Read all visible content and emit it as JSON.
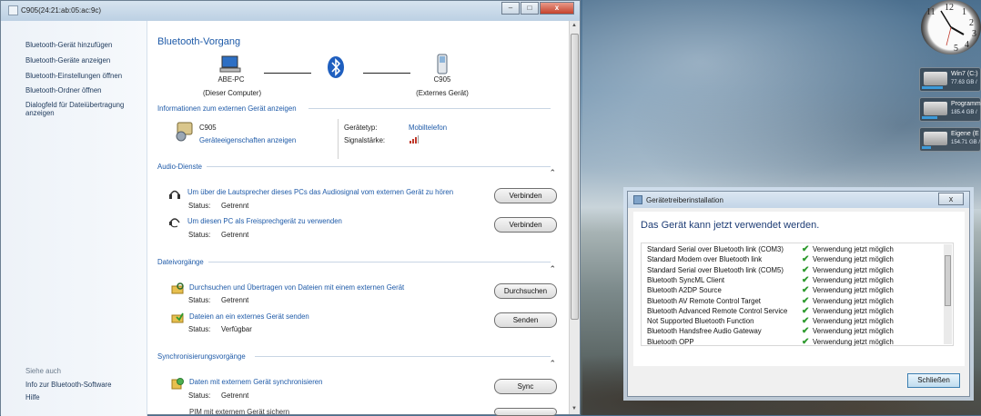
{
  "window": {
    "title": "C905(24:21:ab:05:ac:9c)",
    "buttons": {
      "minimize": "–",
      "maximize": "□",
      "close": "x"
    }
  },
  "sidebar": {
    "items": [
      {
        "label": "Bluetooth-Gerät hinzufügen"
      },
      {
        "label": "Bluetooth-Geräte anzeigen"
      },
      {
        "label": "Bluetooth-Einstellungen öffnen"
      },
      {
        "label": "Bluetooth-Ordner öffnen"
      },
      {
        "label": "Dialogfeld für Dateiübertragung anzeigen"
      }
    ],
    "see_also_title": "Siehe auch",
    "see_also": [
      {
        "label": "Info zur Bluetooth-Software"
      },
      {
        "label": "Hilfe"
      }
    ]
  },
  "main": {
    "title": "Bluetooth-Vorgang",
    "local_device": {
      "name": "ABE-PC",
      "caption": "(Dieser Computer)"
    },
    "remote_device": {
      "name": "C905",
      "caption": "(Externes Gerät)"
    },
    "info_section": {
      "title": "Informationen zum externen Gerät anzeigen",
      "device_name": "C905",
      "properties_link": "Geräteeigenschaften anzeigen",
      "device_type_label": "Gerätetyp:",
      "device_type_value": "Mobiltelefon",
      "signal_label": "Signalstärke:"
    },
    "audio_section": {
      "title": "Audio-Dienste",
      "services": [
        {
          "text": "Um über die Lautsprecher dieses PCs das Audiosignal vom externen Gerät zu hören",
          "status_label": "Status:",
          "status": "Getrennt",
          "button": "Verbinden"
        },
        {
          "text": "Um diesen PC als Freisprechgerät zu verwenden",
          "status_label": "Status:",
          "status": "Getrennt",
          "button": "Verbinden"
        }
      ]
    },
    "file_section": {
      "title": "Dateivorgänge",
      "services": [
        {
          "text": "Durchsuchen und Übertragen von Dateien mit einem externen Gerät",
          "status_label": "Status:",
          "status": "Getrennt",
          "button": "Durchsuchen"
        },
        {
          "text": "Dateien an ein externes Gerät senden",
          "status_label": "Status:",
          "status": "Verfügbar",
          "button": "Senden"
        }
      ]
    },
    "sync_section": {
      "title": "Synchronisierungsvorgänge",
      "services": [
        {
          "text": "Daten mit externem Gerät synchronisieren",
          "status_label": "Status:",
          "status": "Getrennt",
          "button": "Sync"
        }
      ],
      "partial_item": "PIM mit externem Gerät sichern"
    }
  },
  "desktop": {
    "clock_numbers": [
      "11",
      "12",
      "1",
      "2",
      "3",
      "4",
      "5"
    ],
    "drives": [
      {
        "name": "Win7 (C:)",
        "size": "77.63 GB /",
        "fill": 0.35
      },
      {
        "name": "Programm",
        "size": "185.4 GB /",
        "fill": 0.25
      },
      {
        "name": "Eigene (E",
        "size": "154.71 GB /",
        "fill": 0.15
      }
    ]
  },
  "dialog": {
    "title": "Gerätetreiberinstallation",
    "close": "x",
    "message": "Das Gerät kann jetzt verwendet werden.",
    "items": [
      {
        "name": "Standard Serial over Bluetooth link (COM3)",
        "status": "Verwendung jetzt möglich"
      },
      {
        "name": "Standard Modem over Bluetooth link",
        "status": "Verwendung jetzt möglich"
      },
      {
        "name": "Standard Serial over Bluetooth link (COM5)",
        "status": "Verwendung jetzt möglich"
      },
      {
        "name": "Bluetooth SyncML Client",
        "status": "Verwendung jetzt möglich"
      },
      {
        "name": "Bluetooth A2DP Source",
        "status": "Verwendung jetzt möglich"
      },
      {
        "name": "Bluetooth AV Remote Control Target",
        "status": "Verwendung jetzt möglich"
      },
      {
        "name": "Bluetooth Advanced Remote Control Service",
        "status": "Verwendung jetzt möglich"
      },
      {
        "name": "Not Supported Bluetooth Function",
        "status": "Verwendung jetzt möglich"
      },
      {
        "name": "Bluetooth Handsfree Audio Gateway",
        "status": "Verwendung jetzt möglich"
      },
      {
        "name": "Bluetooth OPP",
        "status": "Verwendung jetzt möglich"
      }
    ],
    "button": "Schließen"
  }
}
